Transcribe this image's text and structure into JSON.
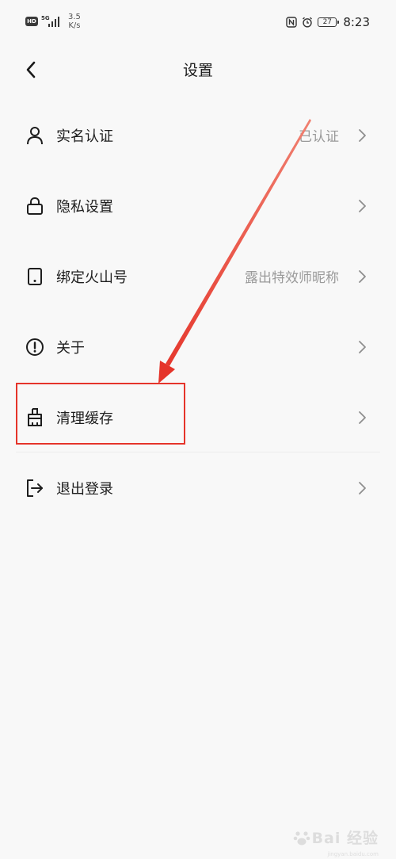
{
  "status_bar": {
    "hd_label": "HD",
    "network_type": "5G",
    "net_speed_value": "3.5",
    "net_speed_unit": "K/s",
    "battery_level": "27",
    "time": "8:23",
    "icons": [
      "nfc-icon",
      "alarm-icon",
      "battery-icon"
    ]
  },
  "header": {
    "back_icon": "chevron-left-icon",
    "title": "设置"
  },
  "settings": {
    "items": [
      {
        "label": "实名认证",
        "value": "已认证",
        "icon": "person-icon"
      },
      {
        "label": "隐私设置",
        "value": "",
        "icon": "lock-icon"
      },
      {
        "label": "绑定火山号",
        "value": "露出特效师昵称",
        "icon": "tablet-icon"
      },
      {
        "label": "关于",
        "value": "",
        "icon": "info-circle-icon"
      },
      {
        "label": "清理缓存",
        "value": "",
        "icon": "brush-icon"
      },
      {
        "label": "退出登录",
        "value": "",
        "icon": "logout-icon"
      }
    ]
  },
  "annotation": {
    "color": "#e5342a",
    "highlighted_item": "清理缓存"
  },
  "watermark": {
    "text": "Bai 经验",
    "sub": "jingyan.baidu.com"
  },
  "colors": {
    "background": "#f8f8f8",
    "text_primary": "#1e1e1e",
    "text_secondary": "#9a9a9a",
    "annotation_red": "#e5342a"
  }
}
